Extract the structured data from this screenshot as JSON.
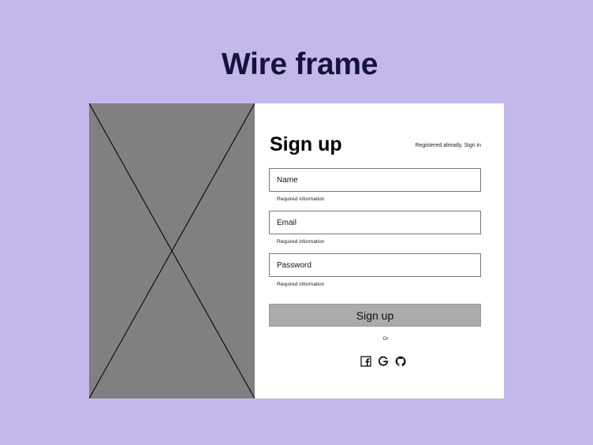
{
  "page": {
    "title": "Wire frame"
  },
  "form": {
    "title": "Sign up",
    "signin_link": "Registered already, Sign in",
    "fields": [
      {
        "placeholder": "Name",
        "hint": "Required information"
      },
      {
        "placeholder": "Email",
        "hint": "Required information"
      },
      {
        "placeholder": "Password",
        "hint": "Required information"
      }
    ],
    "submit_label": "Sign up",
    "divider_text": "Or"
  },
  "social": [
    "facebook-icon",
    "google-icon",
    "github-icon"
  ],
  "colors": {
    "background": "#c4b8ea",
    "title": "#16123e",
    "card": "#fffffd",
    "placeholder_image": "#808080",
    "button": "#ababab"
  }
}
